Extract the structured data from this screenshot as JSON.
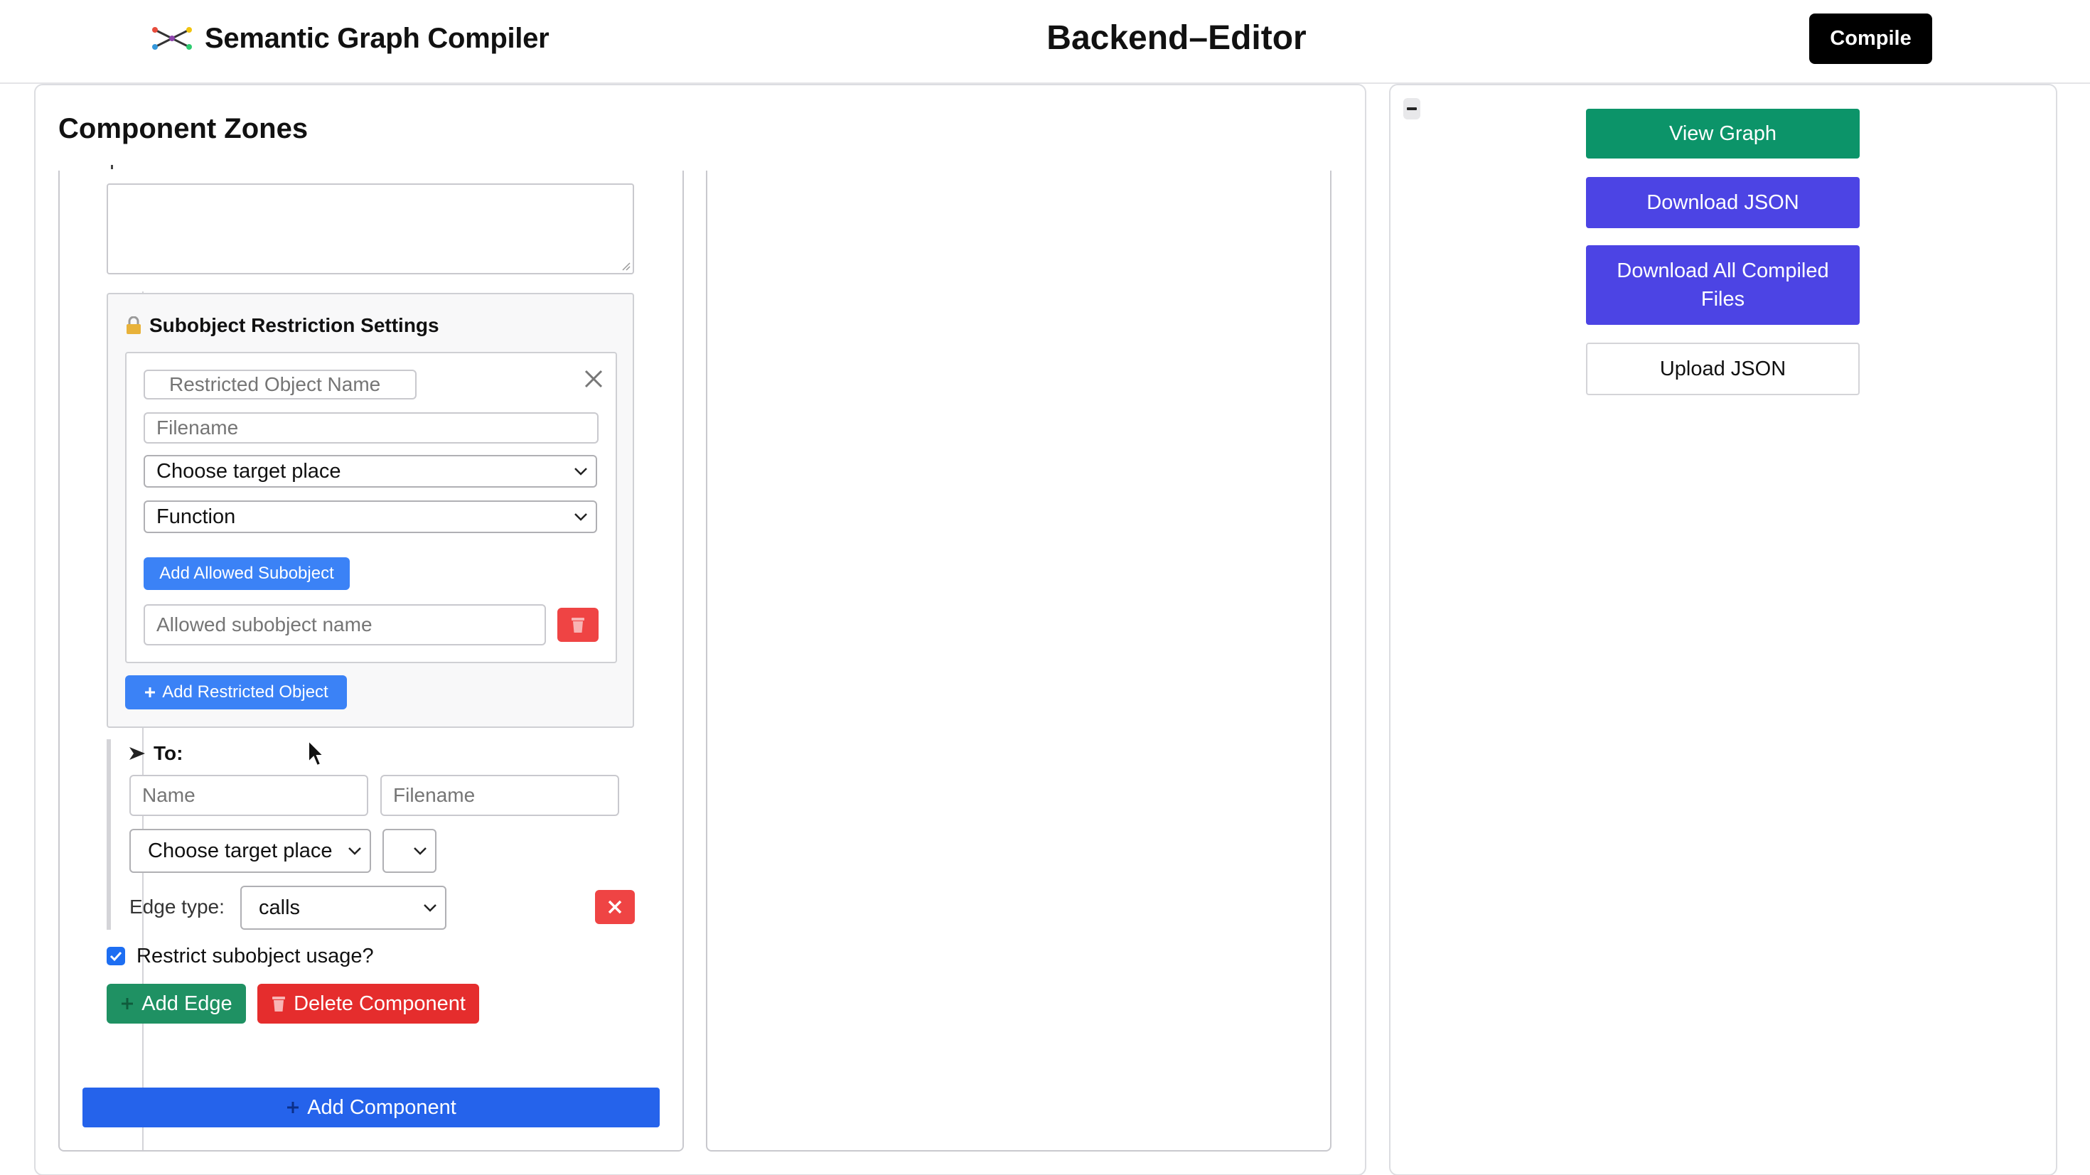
{
  "app": {
    "title": "Semantic Graph Compiler",
    "page_title": "Backend–Editor",
    "compile_label": "Compile",
    "logo_icon": "graph-network-icon"
  },
  "zones": {
    "title": "Component Zones",
    "restriction": {
      "title": "Subobject Restriction Settings",
      "icon": "lock-icon",
      "restricted_name_placeholder": "Restricted Object Name",
      "filename_placeholder": "Filename",
      "target_select": "Choose target place",
      "type_select": "Function",
      "add_allowed_label": "Add Allowed Subobject",
      "allowed_placeholder": "Allowed subobject name",
      "add_restricted_label": "Add Restricted Object"
    },
    "to": {
      "label": "To:",
      "name_placeholder": "Name",
      "filename_placeholder": "Filename",
      "target_select": "Choose target place",
      "extra_select": "",
      "edge_type_label": "Edge type:",
      "edge_type_value": "calls"
    },
    "restrict_checkbox": {
      "label": "Restrict subobject usage?",
      "checked": true
    },
    "add_edge_label": "Add Edge",
    "delete_component_label": "Delete Component",
    "add_component_label": "Add Component"
  },
  "side": {
    "view_graph": "View Graph",
    "download_json": "Download JSON",
    "download_all": "Download All Compiled Files",
    "upload_json": "Upload JSON"
  },
  "colors": {
    "green": "#1f9163",
    "blue": "#2563eb",
    "indigo": "#4c44e4",
    "red": "#e52d2d",
    "black": "#000000"
  }
}
